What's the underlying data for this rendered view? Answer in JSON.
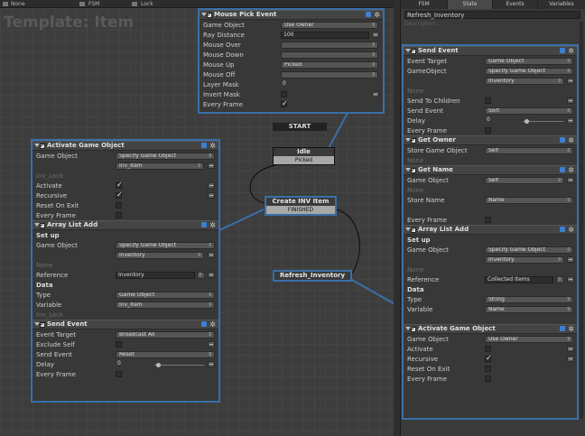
{
  "topbar": {
    "item1": "None",
    "item2": "FSM",
    "item3": "Lock"
  },
  "canvas": {
    "template_title": "Template: Item"
  },
  "states": {
    "start": "START",
    "idle": {
      "name": "Idle",
      "event": "Picked"
    },
    "create": {
      "name": "Create INV Item",
      "event": "FINISHED"
    },
    "refresh": {
      "name": "Refresh_Inventory"
    }
  },
  "mouse_pick": {
    "title": "Mouse Pick Event",
    "rows": [
      {
        "label": "Game Object",
        "value": "Use Owner"
      },
      {
        "label": "Ray Distance",
        "value": "100"
      },
      {
        "label": "Mouse Over",
        "value": ""
      },
      {
        "label": "Mouse Down",
        "value": ""
      },
      {
        "label": "Mouse Up",
        "value": "Picked"
      },
      {
        "label": "Mouse Off",
        "value": ""
      },
      {
        "label": "Layer Mask",
        "value": "0"
      },
      {
        "label": "Invert Mask",
        "value": ""
      },
      {
        "label": "Every Frame",
        "value": ""
      }
    ]
  },
  "left_actions": {
    "activate": {
      "title": "Activate Game Object",
      "game_object_label": "Game Object",
      "game_object_value": "Specify Game Object",
      "game_object_sub": "Inv_Item",
      "none_hint": "Inv_Lock",
      "activate_label": "Activate",
      "recursive_label": "Recursive",
      "reset_label": "Reset On Exit",
      "every_frame_label": "Every Frame"
    },
    "array_list_add": {
      "title": "Array List Add",
      "setup_label": "Set up",
      "game_object_label": "Game Object",
      "game_object_value": "Specify Game Object",
      "game_object_sub": "Inventory",
      "none_hint": "None",
      "reference_label": "Reference",
      "reference_value": "Inventory",
      "data_label": "Data",
      "type_label": "Type",
      "type_value": "Game Object",
      "variable_label": "Variable",
      "variable_value": "Inv_Item",
      "variable_hint": "Inv_Lock"
    },
    "send_event": {
      "title": "Send Event",
      "event_target_label": "Event Target",
      "event_target_value": "Broadcast All",
      "exclude_self_label": "Exclude Self",
      "send_event_label": "Send Event",
      "send_event_value": "Reset",
      "delay_label": "Delay",
      "delay_value": "0",
      "every_frame_label": "Every Frame"
    }
  },
  "right_panel": {
    "tabs": [
      "FSM",
      "State",
      "Events",
      "Variables"
    ],
    "active_tab": "State",
    "state_name": "Refresh_Inventory",
    "description": "Description...",
    "send_event": {
      "title": "Send Event",
      "event_target_label": "Event Target",
      "event_target_value": "Game Object",
      "game_object_label": "GameObject",
      "game_object_value": "Specify Game Object",
      "game_object_sub": "Inventory",
      "none_hint": "None",
      "send_children_label": "Send To Children",
      "send_event_label": "Send Event",
      "send_event_value": "Sort",
      "delay_label": "Delay",
      "delay_value": "0",
      "every_frame_label": "Every Frame"
    },
    "get_owner": {
      "title": "Get Owner",
      "store_label": "Store Game Object",
      "store_value": "Self",
      "none_hint": "None"
    },
    "get_name": {
      "title": "Get Name",
      "game_object_label": "Game Object",
      "game_object_value": "Self",
      "none_hint": "None",
      "store_name_label": "Store Name",
      "store_name_value": "Name",
      "every_frame_label": "Every Frame"
    },
    "array_list_add": {
      "title": "Array List Add",
      "setup_label": "Set up",
      "game_object_label": "Game Object",
      "game_object_value": "Specify Game Object",
      "game_object_sub": "Inventory",
      "none_hint": "None",
      "reference_label": "Reference",
      "reference_value": "Collected Items",
      "data_label": "Data",
      "type_label": "Type",
      "type_value": "String",
      "variable_label": "Variable",
      "variable_value": "Name"
    },
    "activate": {
      "title": "Activate Game Object",
      "game_object_label": "Game Object",
      "game_object_value": "Use Owner",
      "activate_label": "Activate",
      "recursive_label": "Recursive",
      "reset_label": "Reset On Exit",
      "every_frame_label": "Every Frame"
    }
  },
  "colors": {
    "accent": "#3a6fa8",
    "background": "#3d3d3d"
  }
}
